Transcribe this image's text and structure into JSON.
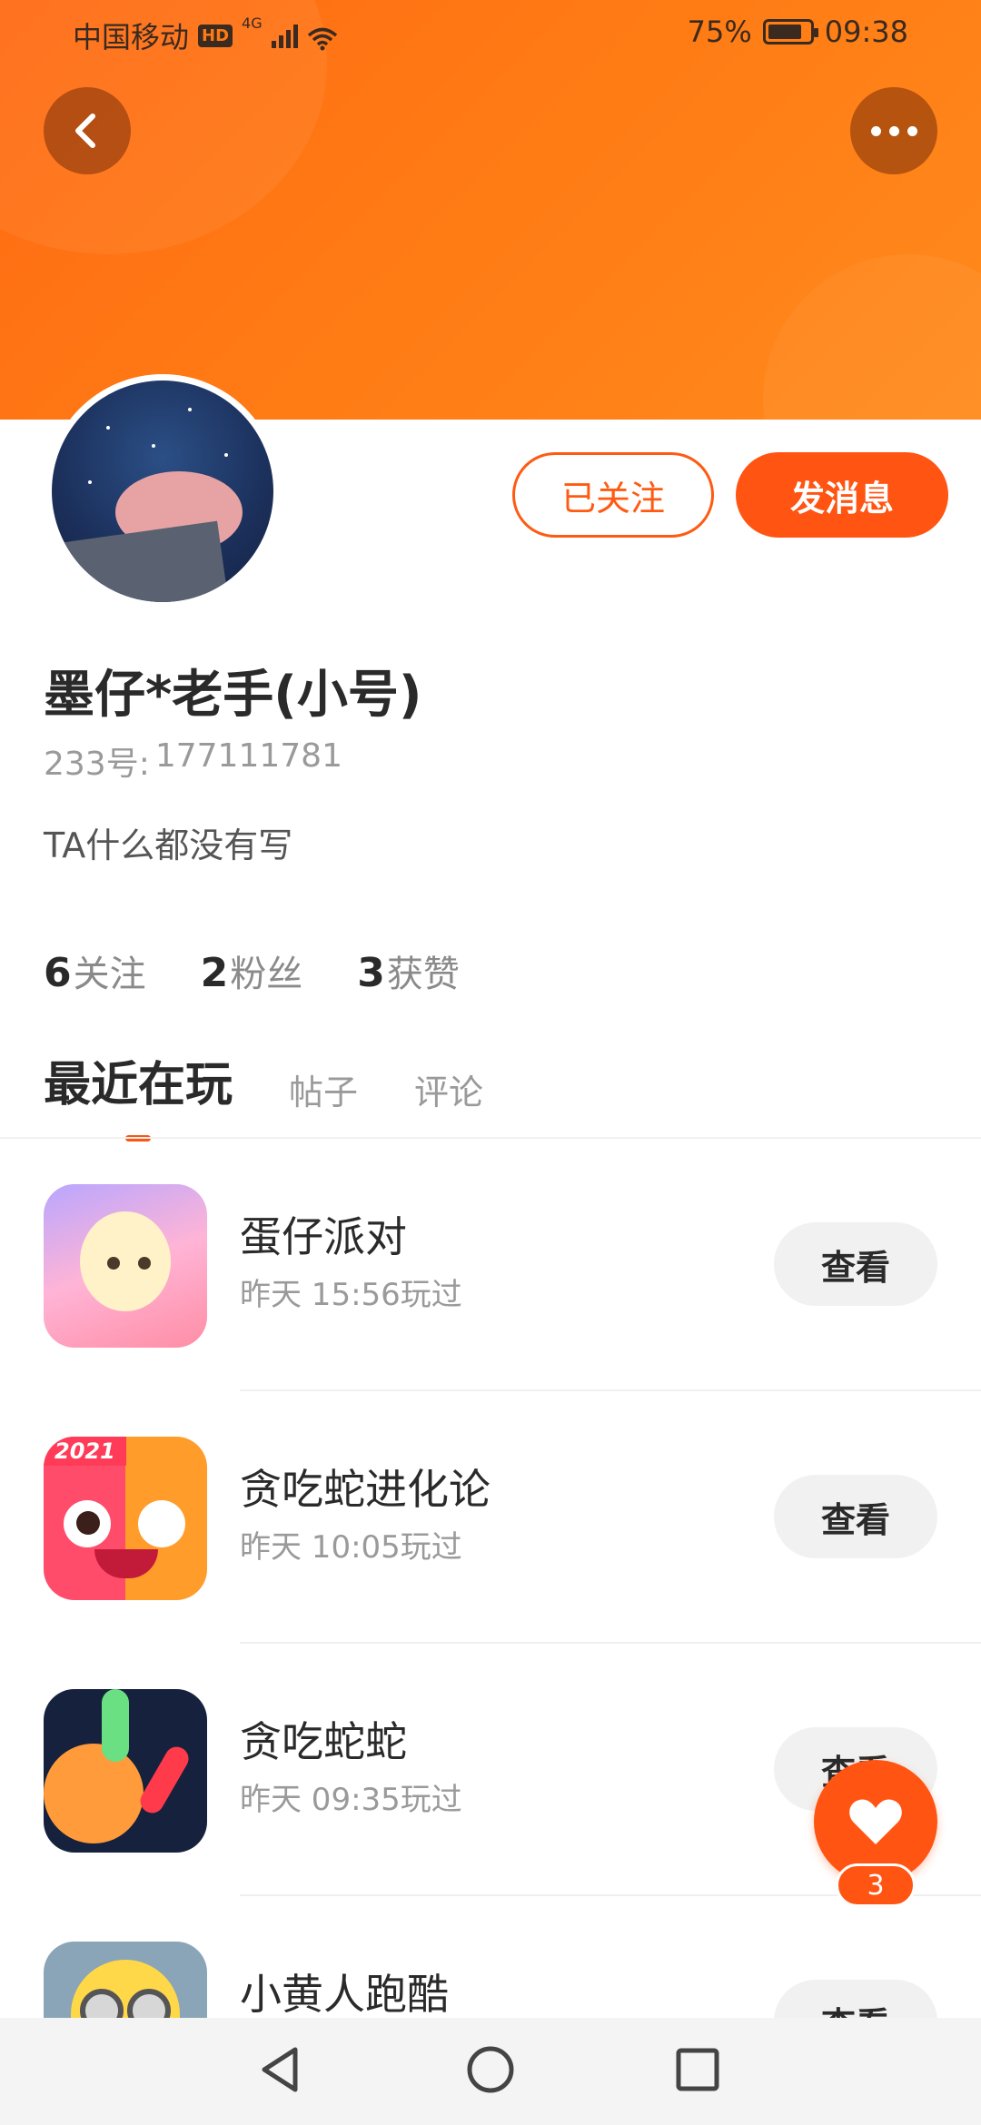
{
  "status_bar": {
    "carrier": "中国移动",
    "hd": "HD",
    "network": "4G",
    "battery": "75%",
    "time": "09:38"
  },
  "profile": {
    "follow_button": "已关注",
    "message_button": "发消息",
    "username": "墨仔*老手(小号)",
    "id_label": "233号:",
    "id_value": "177111781",
    "bio": "TA什么都没有写",
    "stats": [
      {
        "num": "6",
        "label": "关注"
      },
      {
        "num": "2",
        "label": "粉丝"
      },
      {
        "num": "3",
        "label": "获赞"
      }
    ]
  },
  "tabs": [
    {
      "label": "最近在玩",
      "active": true
    },
    {
      "label": "帖子",
      "active": false
    },
    {
      "label": "评论",
      "active": false
    }
  ],
  "games": [
    {
      "name": "蛋仔派对",
      "time": "昨天 15:56玩过",
      "button": "查看"
    },
    {
      "name": "贪吃蛇进化论",
      "time": "昨天 10:05玩过",
      "button": "查看",
      "icon_tag": "2021"
    },
    {
      "name": "贪吃蛇蛇",
      "time": "昨天 09:35玩过",
      "button": "查看"
    },
    {
      "name": "小黄人跑酷",
      "time": "",
      "button": "查看"
    }
  ],
  "like": {
    "count": "3"
  },
  "colors": {
    "accent": "#ff5412",
    "banner": "#ff7a14"
  }
}
